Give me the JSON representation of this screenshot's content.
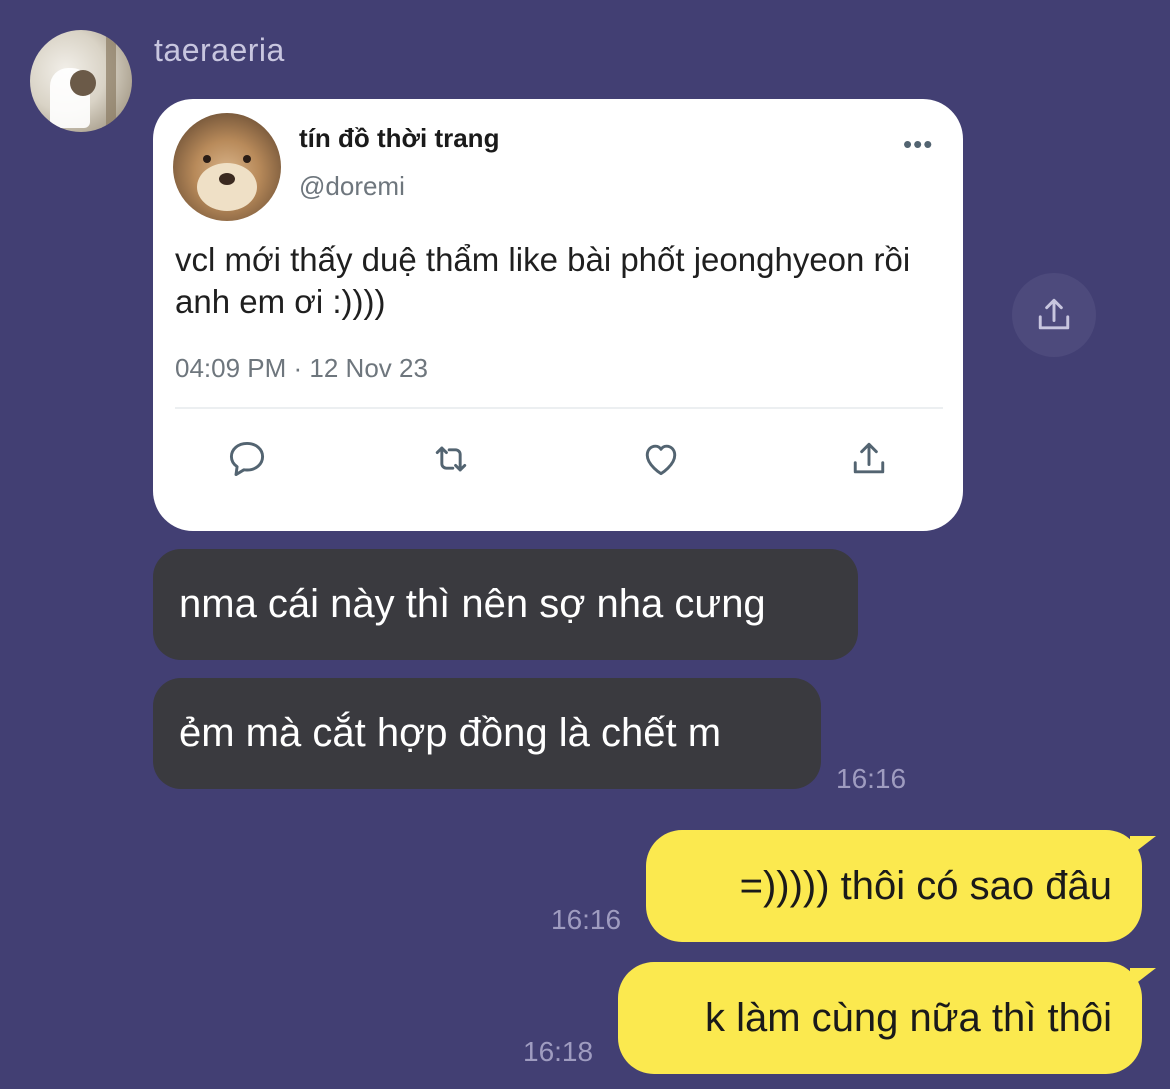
{
  "sender": {
    "name": "taeraeria"
  },
  "tweet": {
    "display_name": "tín đồ thời trang",
    "handle": "@doremi",
    "more_label": "•••",
    "text": "vcl mới thấy duệ thẩm like bài phốt jeonghyeon rồi anh em ơi :))))",
    "timestamp": "04:09 PM · 12 Nov 23",
    "actions": [
      "reply-icon",
      "retweet-icon",
      "like-icon",
      "share-icon"
    ]
  },
  "messages_in": [
    {
      "text": "nma cái này thì nên sợ nha cưng"
    },
    {
      "text": "ẻm mà cắt hợp đồng là chết m",
      "time": "16:16"
    }
  ],
  "messages_out": [
    {
      "text": "=))))) thôi có sao đâu",
      "time": "16:16"
    },
    {
      "text": "k làm cùng nữa thì thôi",
      "time": "16:18"
    }
  ],
  "colors": {
    "background": "#423f73",
    "incoming_bubble": "#3a3a3f",
    "outgoing_bubble": "#fbe94f",
    "timestamp": "#9f9cc0"
  }
}
